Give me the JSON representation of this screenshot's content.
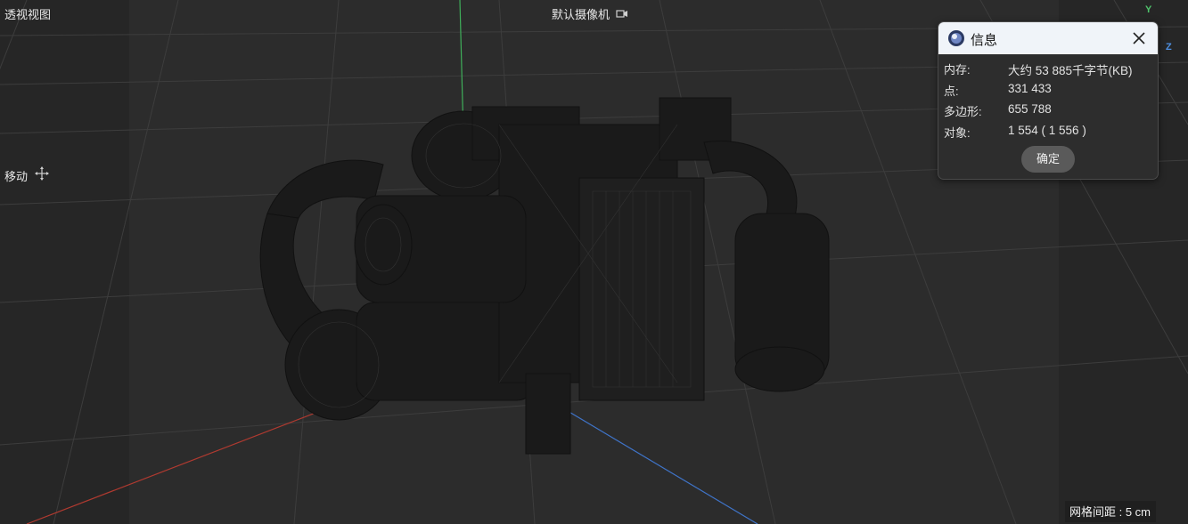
{
  "viewport": {
    "view_name": "透视视图",
    "camera_name": "默认摄像机",
    "camera_icon": "camera-icon",
    "mode_label": "移动",
    "mode_icon": "move-icon",
    "axis_y": "Y",
    "axis_z": "Z",
    "grid_spacing": "网格间距 : 5 cm"
  },
  "info_dialog": {
    "title": "信息",
    "logo_icon": "cinema4d-logo-icon",
    "close_icon": "close-icon",
    "rows": [
      {
        "label": "内存:",
        "value": "大约 53 885千字节(KB)"
      },
      {
        "label": "点:",
        "value": "331 433"
      },
      {
        "label": "多边形:",
        "value": "655 788"
      },
      {
        "label": "对象:",
        "value": "1 554 ( 1 556 )"
      }
    ],
    "ok_label": "确定"
  },
  "colors": {
    "background": "#2b2b2b",
    "axis_x": "#c0392b",
    "axis_y": "#4fc36b",
    "axis_z": "#4e8fe0"
  }
}
